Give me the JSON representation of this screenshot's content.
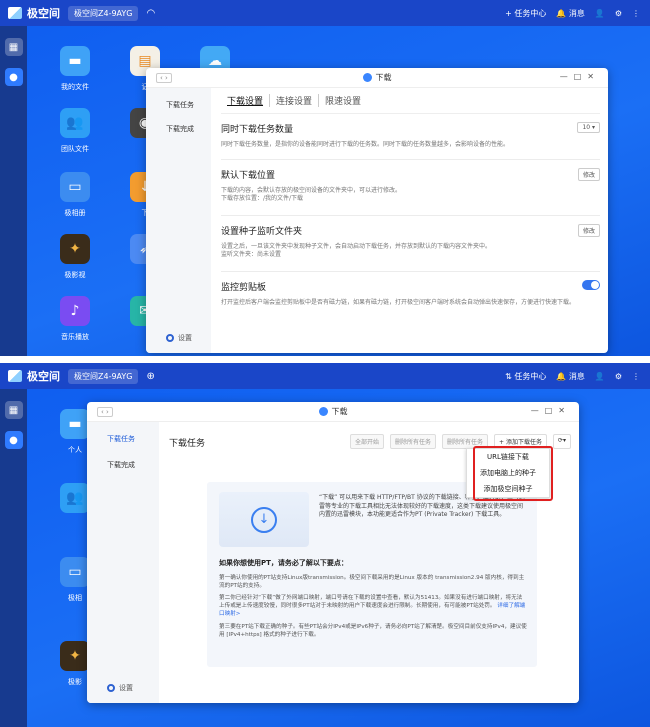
{
  "topbar": {
    "app_name": "极空间",
    "device_top": "极空间Z4-9AYG",
    "device_bottom": "极空间Z4-9AYG",
    "task_center": "任务中心",
    "messages": "消息"
  },
  "desktop_icons_top": [
    "我的文件",
    "记",
    "团队文件",
    "极相册",
    "下",
    "极影视",
    "音乐播放"
  ],
  "desktop_icons_bottom": [
    "个人",
    "极相",
    "极影"
  ],
  "colors": {
    "accent": "#1d5bd8",
    "topbar": "#1a46c8",
    "desktop": "#1565f0",
    "highlight": "#e02020"
  },
  "window1": {
    "title": "下载",
    "sidebar": [
      "下载任务",
      "下载完成"
    ],
    "settings_label": "设置",
    "tabs": [
      "下载设置",
      "连接设置",
      "限速设置"
    ],
    "sections": [
      {
        "title": "同时下载任务数量",
        "desc": "同时下载任务数量，是指你的设备能同时进行下载的任务数。同时下载的任务数量越多，会影响设备的性能。",
        "control": "10"
      },
      {
        "title": "默认下载位置",
        "desc": "下载的内容，会默认存放的极空间设备的文件夹中，可以进行修改。",
        "path": "下载存放位置：/我的文件/下载",
        "control": "修改"
      },
      {
        "title": "设置种子监听文件夹",
        "desc": "设置之后，一旦该文件夹中发现种子文件，会自动启动下载任务，并存放到默认的下载内容文件夹中。",
        "path": "监听文件夹：尚未设置",
        "control": "修改"
      },
      {
        "title": "监控剪贴板",
        "desc": "打开监控后客户端会监控剪贴板中是否有磁力链，如果有磁力链，打开极空间客户端时系统会自动弹出快速保存，方便进行快速下载。",
        "control": "toggle-on"
      }
    ]
  },
  "window2": {
    "title": "下载",
    "sidebar": [
      "下载任务",
      "下载完成"
    ],
    "settings_label": "设置",
    "heading": "下载任务",
    "buttons": [
      "全部开始",
      "删除所有任务",
      "删除所有任务",
      "+ 添加下载任务"
    ],
    "more_icon": "more-icon",
    "menu_items": [
      "URL链接下载",
      "添加电脑上的种子",
      "添加极空间种子"
    ],
    "intro": "“下载” 可以用来下载 HTTP/FTP/BT 协议的下载链接、种子、磁力链，但与迅雷等专业的下载工具相比无法体现较好的下载速度，这类下载建议使用极空间内置的迅雷模块，本功能更适合作为PT (Private Tracker) 下载工具。",
    "pt_title": "如果你想使用PT，请务必了解以下要点：",
    "pt_points": [
      "第一确认你使用的PT站支持Linux版transmission。极空间下载采用的是Linux 版本的 transmission2.94 版内核，得到主流的PT站的支持。",
      "第二你已经针对“下载”做了外网端口映射，端口号请在下载的设置中查看，默认为51413。如果没有进行端口映射，将无法上传或是上传速度较慢，同时很多PT站对于未映射的用户下载速度会进行限制。长期使用，有可能被PT站处罚。",
      "第三要在PT站下载正确的种子。有些PT站会分IPv4或是IPv6种子，请务必向PT站了解清楚。极空间目前仅支持IPv4，建议使用 [IPv4+https] 格式的种子进行下载。"
    ],
    "link": "详细了解端口映射>"
  }
}
